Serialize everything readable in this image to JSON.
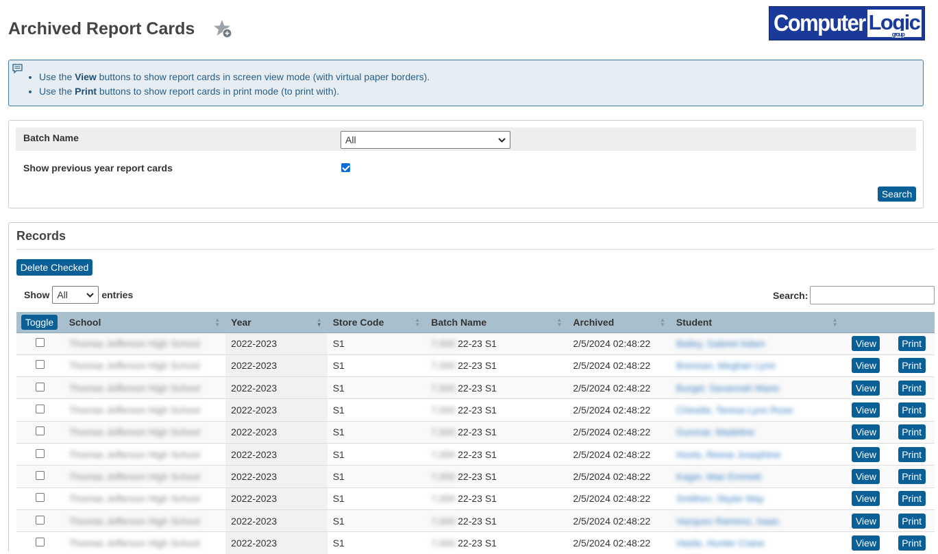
{
  "page": {
    "title": "Archived Report Cards",
    "logo_word1": "Computer",
    "logo_word2": "Logic",
    "logo_word3": "group"
  },
  "info": {
    "line1_pre": "Use the ",
    "line1_bold": "View",
    "line1_post": " buttons to show report cards in screen view mode (with virtual paper borders).",
    "line2_pre": "Use the ",
    "line2_bold": "Print",
    "line2_post": " buttons to show report cards in print mode (to print with)."
  },
  "filters": {
    "batch_label": "Batch Name",
    "batch_value": "All",
    "prev_year_label": "Show previous year report cards",
    "prev_year_checked": true,
    "search_button": "Search"
  },
  "records": {
    "title": "Records",
    "delete_button": "Delete Checked",
    "show_label": "Show",
    "entries_value": "All",
    "entries_label": "entries",
    "search_label": "Search:",
    "search_value": "",
    "toggle_button": "Toggle",
    "columns": [
      "School",
      "Year",
      "Store Code",
      "Batch Name",
      "Archived",
      "Student"
    ],
    "view_label": "View",
    "print_label": "Print",
    "rows": [
      {
        "school": "Thomas Jefferson High School",
        "year": "2022-2023",
        "store": "S1",
        "batch_prefix": "7,000",
        "batch": "22-23 S1",
        "archived": "2/5/2024 02:48:22",
        "student": "Bailey, Gabriel Adam"
      },
      {
        "school": "Thomas Jefferson High School",
        "year": "2022-2023",
        "store": "S1",
        "batch_prefix": "7,000",
        "batch": "22-23 S1",
        "archived": "2/5/2024 02:48:22",
        "student": "Brennan, Meghan Lynn"
      },
      {
        "school": "Thomas Jefferson High School",
        "year": "2022-2023",
        "store": "S1",
        "batch_prefix": "7,000",
        "batch": "22-23 S1",
        "archived": "2/5/2024 02:48:22",
        "student": "Burgel, Savannah Marie"
      },
      {
        "school": "Thomas Jefferson High School",
        "year": "2022-2023",
        "store": "S1",
        "batch_prefix": "7,000",
        "batch": "22-23 S1",
        "archived": "2/5/2024 02:48:22",
        "student": "Chinelle, Teresa Lynn Rose"
      },
      {
        "school": "Thomas Jefferson High School",
        "year": "2022-2023",
        "store": "S1",
        "batch_prefix": "7,000",
        "batch": "22-23 S1",
        "archived": "2/5/2024 02:48:22",
        "student": "Gunmar, Madeline"
      },
      {
        "school": "Thomas Jefferson High School",
        "year": "2022-2023",
        "store": "S1",
        "batch_prefix": "7,000",
        "batch": "22-23 S1",
        "archived": "2/5/2024 02:48:22",
        "student": "Hoots, Reese Josephine"
      },
      {
        "school": "Thomas Jefferson High School",
        "year": "2022-2023",
        "store": "S1",
        "batch_prefix": "7,000",
        "batch": "22-23 S1",
        "archived": "2/5/2024 02:48:22",
        "student": "Kager, Mae Emmett"
      },
      {
        "school": "Thomas Jefferson High School",
        "year": "2022-2023",
        "store": "S1",
        "batch_prefix": "7,000",
        "batch": "22-23 S1",
        "archived": "2/5/2024 02:48:22",
        "student": "Smithen, Skyler May"
      },
      {
        "school": "Thomas Jefferson High School",
        "year": "2022-2023",
        "store": "S1",
        "batch_prefix": "7,000",
        "batch": "22-23 S1",
        "archived": "2/5/2024 02:48:22",
        "student": "Vazquez Ramirez, Isaac"
      },
      {
        "school": "Thomas Jefferson High School",
        "year": "2022-2023",
        "store": "S1",
        "batch_prefix": "7,000",
        "batch": "22-23 S1",
        "archived": "2/5/2024 02:48:22",
        "student": "Vasile, Hunter Crane"
      }
    ]
  },
  "colors": {
    "accent": "#0b5f97",
    "header_bg": "#a8c0cd",
    "info_bg": "#e6eef3",
    "logo_bg": "#1a3a9a"
  }
}
